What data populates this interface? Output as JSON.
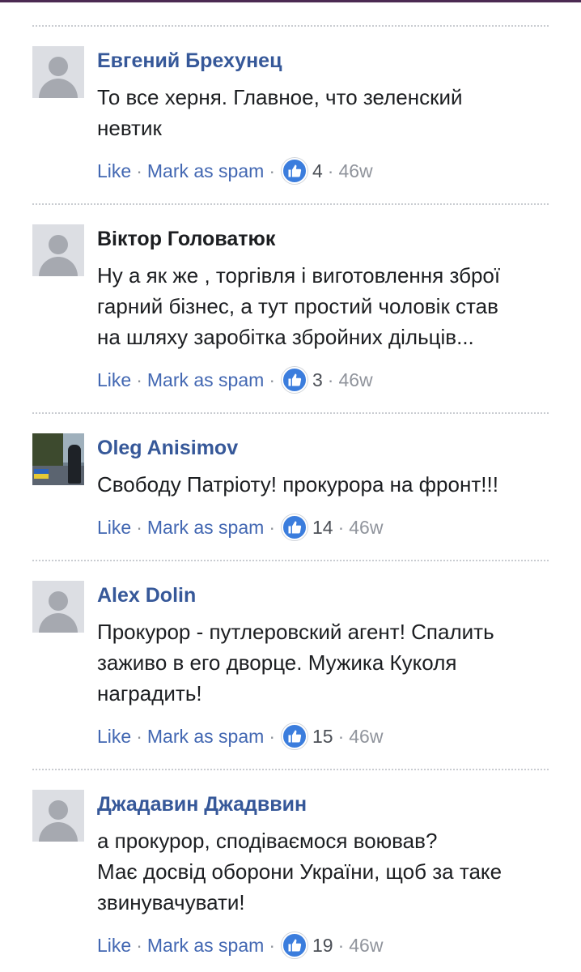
{
  "comments": [
    {
      "author": "Евгений Брехунец",
      "author_link": true,
      "text_lines": [
        "То все херня. Главное, что зеленский",
        "невтик"
      ],
      "like_label": "Like",
      "spam_label": "Mark as spam",
      "likes": "4",
      "time": "46w",
      "avatar": "default-avatar-icon"
    },
    {
      "author": "Віктор Головатюк",
      "author_link": false,
      "text_lines": [
        "Ну а як же , торгівля і виготовлення зброї",
        "гарний бізнес, а тут простий чоловік став",
        "на шляху заробітка збройних дільців..."
      ],
      "like_label": "Like",
      "spam_label": "Mark as spam",
      "likes": "3",
      "time": "46w",
      "avatar": "default-avatar-icon"
    },
    {
      "author": "Oleg Anisimov",
      "author_link": true,
      "text_lines": [
        "Свободу Патріоту! прокурора на фронт!!!"
      ],
      "like_label": "Like",
      "spam_label": "Mark as spam",
      "likes": "14",
      "time": "46w",
      "avatar": "photo-avatar"
    },
    {
      "author": "Alex Dolin",
      "author_link": true,
      "text_lines": [
        "Прокурор - путлеровский агент! Спалить",
        "заживо в его дворце. Мужика Куколя",
        "наградить!"
      ],
      "like_label": "Like",
      "spam_label": "Mark as spam",
      "likes": "15",
      "time": "46w",
      "avatar": "default-avatar-icon"
    },
    {
      "author": "Джадавин Джадввин",
      "author_link": true,
      "text_lines": [
        "а прокурор, сподіваємося воював?",
        "Має досвід оборони України, щоб за таке",
        "звинувачувати!"
      ],
      "like_label": "Like",
      "spam_label": "Mark as spam",
      "likes": "19",
      "time": "46w",
      "avatar": "default-avatar-icon"
    }
  ],
  "colors": {
    "link": "#4267b2",
    "author": "#365899",
    "like_badge": "#3b7ddd",
    "top_border": "#4b2a52"
  },
  "separator_dot": "·"
}
